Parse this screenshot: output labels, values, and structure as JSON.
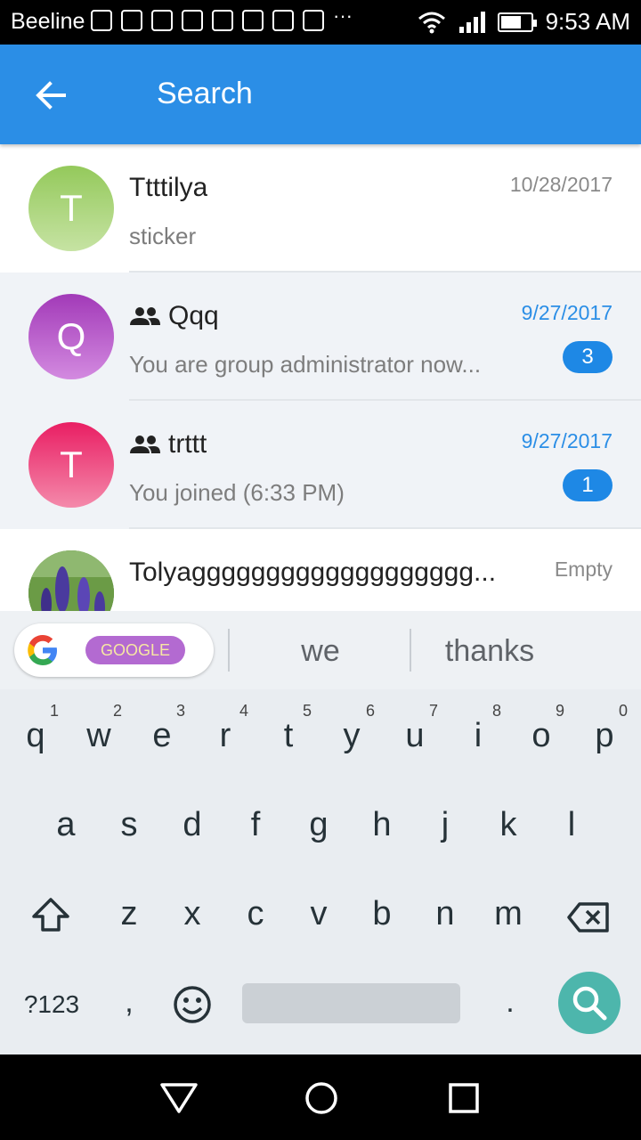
{
  "status_bar": {
    "carrier": "Beeline",
    "time": "9:53 AM",
    "battery_level_percent": 70
  },
  "app_bar": {
    "title": "Search",
    "back_icon": "arrow-back-icon"
  },
  "chats": [
    {
      "name": "Ttttilya",
      "avatar_letter": "T",
      "avatar_color": "#9ccc65",
      "date": "10/28/2017",
      "preview": "sticker",
      "group": false,
      "unread": null
    },
    {
      "name": "Qqq",
      "avatar_letter": "Q",
      "avatar_color": "#ab47bc",
      "date": "9/27/2017",
      "preview": "You are group administrator now...",
      "group": true,
      "unread": "3"
    },
    {
      "name": "trttt",
      "avatar_letter": "T",
      "avatar_color": "#ec407a",
      "date": "9/27/2017",
      "preview": "You joined (6:33 PM)",
      "group": true,
      "unread": "1"
    },
    {
      "name": "Tolyaggggggggggggggggggg...",
      "avatar_letter": "",
      "avatar_color": "#5c8a3a",
      "date": "Empty",
      "preview": "",
      "group": false,
      "unread": null
    }
  ],
  "keyboard": {
    "suggestions": [
      "we",
      "thanks"
    ],
    "doodle_text": "GOOGLE",
    "row1": [
      {
        "key": "q",
        "hint": "1"
      },
      {
        "key": "w",
        "hint": "2"
      },
      {
        "key": "e",
        "hint": "3"
      },
      {
        "key": "r",
        "hint": "4"
      },
      {
        "key": "t",
        "hint": "5"
      },
      {
        "key": "y",
        "hint": "6"
      },
      {
        "key": "u",
        "hint": "7"
      },
      {
        "key": "i",
        "hint": "8"
      },
      {
        "key": "o",
        "hint": "9"
      },
      {
        "key": "p",
        "hint": "0"
      }
    ],
    "row2": [
      "a",
      "s",
      "d",
      "f",
      "g",
      "h",
      "j",
      "k",
      "l"
    ],
    "row3": [
      "z",
      "x",
      "c",
      "v",
      "b",
      "n",
      "m"
    ],
    "symbols_label": "?123",
    "comma": ",",
    "period": "."
  },
  "colors": {
    "app_bar": "#2b8ee6",
    "badge": "#1e88e5",
    "search_key": "#4db6ac"
  }
}
